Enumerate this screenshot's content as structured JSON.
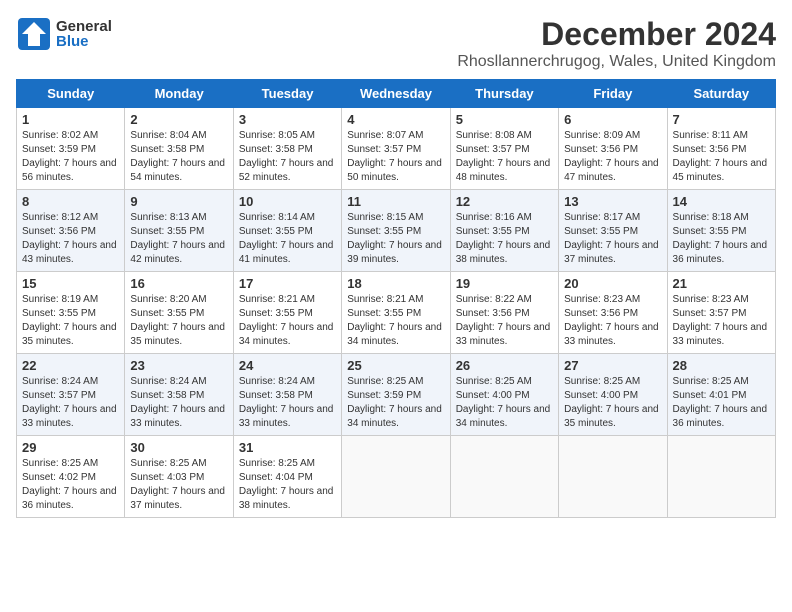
{
  "header": {
    "logo_general": "General",
    "logo_blue": "Blue",
    "title": "December 2024",
    "subtitle": "Rhosllannerchrugog, Wales, United Kingdom"
  },
  "calendar": {
    "days_of_week": [
      "Sunday",
      "Monday",
      "Tuesday",
      "Wednesday",
      "Thursday",
      "Friday",
      "Saturday"
    ],
    "weeks": [
      [
        {
          "day": "1",
          "sunrise": "Sunrise: 8:02 AM",
          "sunset": "Sunset: 3:59 PM",
          "daylight": "Daylight: 7 hours and 56 minutes."
        },
        {
          "day": "2",
          "sunrise": "Sunrise: 8:04 AM",
          "sunset": "Sunset: 3:58 PM",
          "daylight": "Daylight: 7 hours and 54 minutes."
        },
        {
          "day": "3",
          "sunrise": "Sunrise: 8:05 AM",
          "sunset": "Sunset: 3:58 PM",
          "daylight": "Daylight: 7 hours and 52 minutes."
        },
        {
          "day": "4",
          "sunrise": "Sunrise: 8:07 AM",
          "sunset": "Sunset: 3:57 PM",
          "daylight": "Daylight: 7 hours and 50 minutes."
        },
        {
          "day": "5",
          "sunrise": "Sunrise: 8:08 AM",
          "sunset": "Sunset: 3:57 PM",
          "daylight": "Daylight: 7 hours and 48 minutes."
        },
        {
          "day": "6",
          "sunrise": "Sunrise: 8:09 AM",
          "sunset": "Sunset: 3:56 PM",
          "daylight": "Daylight: 7 hours and 47 minutes."
        },
        {
          "day": "7",
          "sunrise": "Sunrise: 8:11 AM",
          "sunset": "Sunset: 3:56 PM",
          "daylight": "Daylight: 7 hours and 45 minutes."
        }
      ],
      [
        {
          "day": "8",
          "sunrise": "Sunrise: 8:12 AM",
          "sunset": "Sunset: 3:56 PM",
          "daylight": "Daylight: 7 hours and 43 minutes."
        },
        {
          "day": "9",
          "sunrise": "Sunrise: 8:13 AM",
          "sunset": "Sunset: 3:55 PM",
          "daylight": "Daylight: 7 hours and 42 minutes."
        },
        {
          "day": "10",
          "sunrise": "Sunrise: 8:14 AM",
          "sunset": "Sunset: 3:55 PM",
          "daylight": "Daylight: 7 hours and 41 minutes."
        },
        {
          "day": "11",
          "sunrise": "Sunrise: 8:15 AM",
          "sunset": "Sunset: 3:55 PM",
          "daylight": "Daylight: 7 hours and 39 minutes."
        },
        {
          "day": "12",
          "sunrise": "Sunrise: 8:16 AM",
          "sunset": "Sunset: 3:55 PM",
          "daylight": "Daylight: 7 hours and 38 minutes."
        },
        {
          "day": "13",
          "sunrise": "Sunrise: 8:17 AM",
          "sunset": "Sunset: 3:55 PM",
          "daylight": "Daylight: 7 hours and 37 minutes."
        },
        {
          "day": "14",
          "sunrise": "Sunrise: 8:18 AM",
          "sunset": "Sunset: 3:55 PM",
          "daylight": "Daylight: 7 hours and 36 minutes."
        }
      ],
      [
        {
          "day": "15",
          "sunrise": "Sunrise: 8:19 AM",
          "sunset": "Sunset: 3:55 PM",
          "daylight": "Daylight: 7 hours and 35 minutes."
        },
        {
          "day": "16",
          "sunrise": "Sunrise: 8:20 AM",
          "sunset": "Sunset: 3:55 PM",
          "daylight": "Daylight: 7 hours and 35 minutes."
        },
        {
          "day": "17",
          "sunrise": "Sunrise: 8:21 AM",
          "sunset": "Sunset: 3:55 PM",
          "daylight": "Daylight: 7 hours and 34 minutes."
        },
        {
          "day": "18",
          "sunrise": "Sunrise: 8:21 AM",
          "sunset": "Sunset: 3:55 PM",
          "daylight": "Daylight: 7 hours and 34 minutes."
        },
        {
          "day": "19",
          "sunrise": "Sunrise: 8:22 AM",
          "sunset": "Sunset: 3:56 PM",
          "daylight": "Daylight: 7 hours and 33 minutes."
        },
        {
          "day": "20",
          "sunrise": "Sunrise: 8:23 AM",
          "sunset": "Sunset: 3:56 PM",
          "daylight": "Daylight: 7 hours and 33 minutes."
        },
        {
          "day": "21",
          "sunrise": "Sunrise: 8:23 AM",
          "sunset": "Sunset: 3:57 PM",
          "daylight": "Daylight: 7 hours and 33 minutes."
        }
      ],
      [
        {
          "day": "22",
          "sunrise": "Sunrise: 8:24 AM",
          "sunset": "Sunset: 3:57 PM",
          "daylight": "Daylight: 7 hours and 33 minutes."
        },
        {
          "day": "23",
          "sunrise": "Sunrise: 8:24 AM",
          "sunset": "Sunset: 3:58 PM",
          "daylight": "Daylight: 7 hours and 33 minutes."
        },
        {
          "day": "24",
          "sunrise": "Sunrise: 8:24 AM",
          "sunset": "Sunset: 3:58 PM",
          "daylight": "Daylight: 7 hours and 33 minutes."
        },
        {
          "day": "25",
          "sunrise": "Sunrise: 8:25 AM",
          "sunset": "Sunset: 3:59 PM",
          "daylight": "Daylight: 7 hours and 34 minutes."
        },
        {
          "day": "26",
          "sunrise": "Sunrise: 8:25 AM",
          "sunset": "Sunset: 4:00 PM",
          "daylight": "Daylight: 7 hours and 34 minutes."
        },
        {
          "day": "27",
          "sunrise": "Sunrise: 8:25 AM",
          "sunset": "Sunset: 4:00 PM",
          "daylight": "Daylight: 7 hours and 35 minutes."
        },
        {
          "day": "28",
          "sunrise": "Sunrise: 8:25 AM",
          "sunset": "Sunset: 4:01 PM",
          "daylight": "Daylight: 7 hours and 36 minutes."
        }
      ],
      [
        {
          "day": "29",
          "sunrise": "Sunrise: 8:25 AM",
          "sunset": "Sunset: 4:02 PM",
          "daylight": "Daylight: 7 hours and 36 minutes."
        },
        {
          "day": "30",
          "sunrise": "Sunrise: 8:25 AM",
          "sunset": "Sunset: 4:03 PM",
          "daylight": "Daylight: 7 hours and 37 minutes."
        },
        {
          "day": "31",
          "sunrise": "Sunrise: 8:25 AM",
          "sunset": "Sunset: 4:04 PM",
          "daylight": "Daylight: 7 hours and 38 minutes."
        },
        null,
        null,
        null,
        null
      ]
    ]
  }
}
